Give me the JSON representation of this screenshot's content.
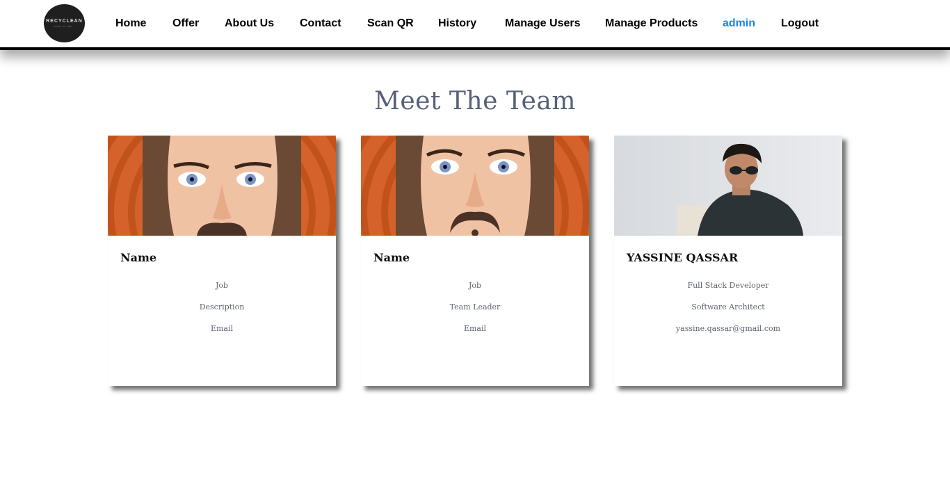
{
  "header": {
    "logo": {
      "name": "RECYCLEAN",
      "tagline": "GOOD TO THE ..."
    },
    "nav": [
      {
        "label": "Home"
      },
      {
        "label": "Offer"
      },
      {
        "label": "About Us"
      },
      {
        "label": "Contact"
      },
      {
        "label": "Scan QR"
      },
      {
        "label": "History"
      },
      {
        "label": "Manage Users"
      },
      {
        "label": "Manage Products"
      },
      {
        "label": "admin",
        "active": true
      },
      {
        "label": "Logout"
      }
    ],
    "active_color": "#1a86e6",
    "border_color": "#000000"
  },
  "main": {
    "title": "Meet The Team",
    "title_color": "#566079",
    "cards": [
      {
        "image": "cartoon-avatar",
        "name": "Name",
        "line1": "Job",
        "line2": "Description",
        "line3": "Email"
      },
      {
        "image": "cartoon-avatar",
        "name": "Name",
        "line1": "Job",
        "line2": "Team Leader",
        "line3": "Email"
      },
      {
        "image": "photo-portrait",
        "name": "YASSINE QASSAR",
        "line1": "Full Stack Developer",
        "line2": "Software Architect",
        "line3": "yassine.qassar@gmail.com"
      }
    ],
    "avatar_bg_color": "#d4622a"
  }
}
